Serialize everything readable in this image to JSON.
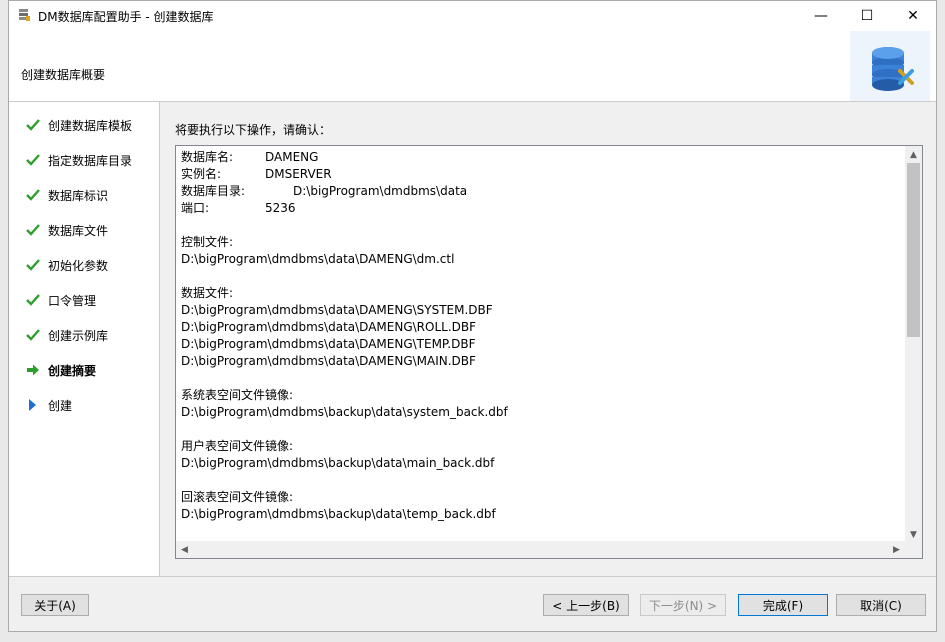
{
  "window": {
    "title": "DM数据库配置助手 - 创建数据库",
    "minimize": "—",
    "maximize": "☐",
    "close": "✕"
  },
  "header": {
    "title": "创建数据库概要"
  },
  "sidebar": {
    "steps": [
      {
        "label": "创建数据库模板",
        "state": "done"
      },
      {
        "label": "指定数据库目录",
        "state": "done"
      },
      {
        "label": "数据库标识",
        "state": "done"
      },
      {
        "label": "数据库文件",
        "state": "done"
      },
      {
        "label": "初始化参数",
        "state": "done"
      },
      {
        "label": "口令管理",
        "state": "done"
      },
      {
        "label": "创建示例库",
        "state": "done"
      },
      {
        "label": "创建摘要",
        "state": "current"
      },
      {
        "label": "创建",
        "state": "pending"
      }
    ]
  },
  "main": {
    "confirm_label": "将要执行以下操作，请确认：",
    "summary": {
      "db_name_label": "数据库名:",
      "db_name": "DAMENG",
      "instance_label": "实例名:",
      "instance": "DMSERVER",
      "db_dir_label": "数据库目录:",
      "db_dir": "D:\\bigProgram\\dmdbms\\data",
      "port_label": "端口:",
      "port": "5236",
      "control_label": "控制文件:",
      "control_file": "D:\\bigProgram\\dmdbms\\data\\DAMENG\\dm.ctl",
      "data_label": "数据文件:",
      "data_files": [
        "D:\\bigProgram\\dmdbms\\data\\DAMENG\\SYSTEM.DBF",
        "D:\\bigProgram\\dmdbms\\data\\DAMENG\\ROLL.DBF",
        "D:\\bigProgram\\dmdbms\\data\\DAMENG\\TEMP.DBF",
        "D:\\bigProgram\\dmdbms\\data\\DAMENG\\MAIN.DBF"
      ],
      "sys_mirror_label": "系统表空间文件镜像:",
      "sys_mirror": "D:\\bigProgram\\dmdbms\\backup\\data\\system_back.dbf",
      "user_mirror_label": "用户表空间文件镜像:",
      "user_mirror": "D:\\bigProgram\\dmdbms\\backup\\data\\main_back.dbf",
      "rollback_mirror_label": "回滚表空间文件镜像:",
      "rollback_mirror": "D:\\bigProgram\\dmdbms\\backup\\data\\temp_back.dbf"
    }
  },
  "footer": {
    "about": "关于(A)",
    "back": "< 上一步(B)",
    "next": "下一步(N) >",
    "finish": "完成(F)",
    "cancel": "取消(C)"
  },
  "colors": {
    "check": "#2f9e2f",
    "arrow_current": "#2f9e2f",
    "arrow_pending": "#1e6fd0"
  },
  "icons": {
    "done": "check-icon",
    "current": "arrow-right-icon",
    "pending": "triangle-right-icon"
  }
}
